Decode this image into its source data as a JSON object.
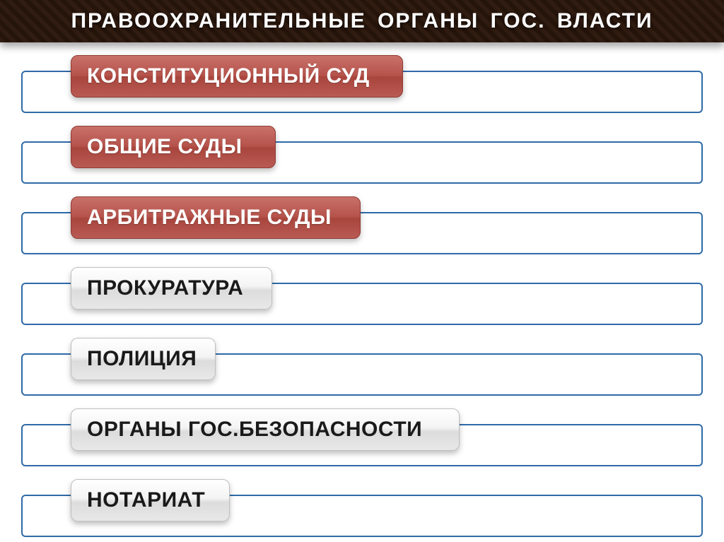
{
  "header": {
    "title": "ПРАВООХРАНИТЕЛЬНЫЕ  ОРГАНЫ  ГОС.  ВЛАСТИ"
  },
  "items": [
    {
      "label": "КОНСТИТУЦИОННЫЙ СУД",
      "style": "red"
    },
    {
      "label": "ОБЩИЕ СУДЫ",
      "style": "red"
    },
    {
      "label": "АРБИТРАЖНЫЕ СУДЫ",
      "style": "red"
    },
    {
      "label": "ПРОКУРАТУРА",
      "style": "gray"
    },
    {
      "label": "ПОЛИЦИЯ",
      "style": "gray"
    },
    {
      "label": "ОРГАНЫ ГОС.БЕЗОПАСНОСТИ",
      "style": "gray"
    },
    {
      "label": "НОТАРИАТ",
      "style": "gray"
    }
  ],
  "colors": {
    "frame_border": "#2f6aa8",
    "pill_red": "#b5534b",
    "pill_gray": "#e8e8e8"
  }
}
